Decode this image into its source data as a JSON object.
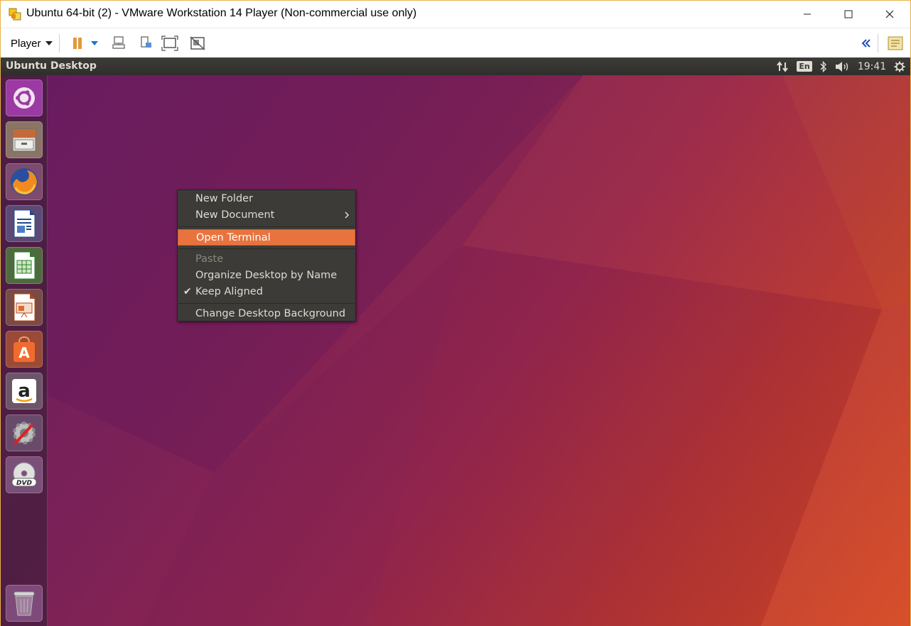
{
  "window": {
    "title": "Ubuntu 64-bit (2) - VMware Workstation 14 Player (Non-commercial use only)",
    "controls": [
      "minimize",
      "maximize",
      "close"
    ]
  },
  "toolbar": {
    "player_label": "Player",
    "icons": [
      "pause-icon",
      "send-ctrl-alt-del-icon",
      "removable-devices-icon",
      "fullscreen-icon",
      "unity-icon",
      "back-icon",
      "library-icon"
    ]
  },
  "ubuntu_panel": {
    "title": "Ubuntu Desktop",
    "lang": "En",
    "time": "19:41"
  },
  "launcher": {
    "items": [
      "dash",
      "files",
      "firefox",
      "libreoffice-writer",
      "libreoffice-calc",
      "libreoffice-impress",
      "ubuntu-software",
      "amazon",
      "system-settings",
      "dvd",
      "trash"
    ]
  },
  "context_menu": {
    "items": [
      {
        "label": "New Folder"
      },
      {
        "label": "New Document",
        "submenu": true
      },
      {
        "label": "Open Terminal",
        "highlighted": true
      },
      {
        "label": "Paste",
        "disabled": true
      },
      {
        "label": "Organize Desktop by Name"
      },
      {
        "label": "Keep Aligned",
        "checked": true
      },
      {
        "label": "Change Desktop Background"
      }
    ]
  },
  "colors": {
    "accent": "#e7743f",
    "panel": "#3c3b37",
    "window_border": "#e8b34a"
  }
}
